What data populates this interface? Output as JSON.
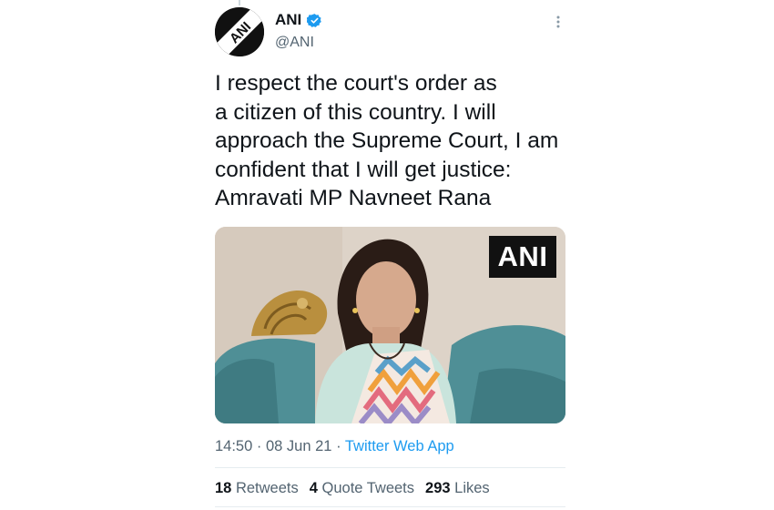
{
  "tweet": {
    "author_name": "ANI",
    "author_handle": "@ANI",
    "avatar_text": "ANI",
    "verified": true,
    "text": "I respect the court's order as\na citizen of this country. I will\napproach the Supreme Court, I am\nconfident that I will get justice:\nAmravati MP Navneet Rana",
    "media": {
      "watermark": "ANI"
    },
    "time": "14:50",
    "separator": "·",
    "date": "08 Jun 21",
    "source": "Twitter Web App",
    "stats": {
      "retweets_count": "18",
      "retweets_label": "Retweets",
      "quotes_count": "4",
      "quotes_label": "Quote Tweets",
      "likes_count": "293",
      "likes_label": "Likes"
    }
  },
  "colors": {
    "link": "#1d9bf0",
    "secondary_text": "#536471",
    "primary_text": "#0f1419",
    "verified_badge": "#1d9bf0"
  },
  "icons": {
    "more": "more-vertical-icon",
    "verified": "verified-badge-icon"
  }
}
